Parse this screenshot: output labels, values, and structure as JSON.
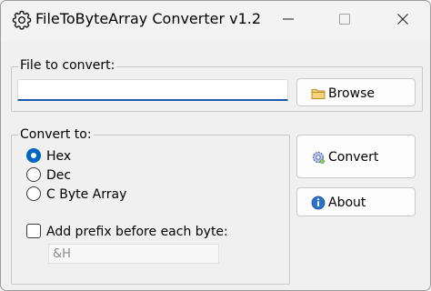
{
  "window": {
    "title": "FileToByteArray Converter v1.2",
    "app_icon": "gear-icon",
    "controls": [
      "minimize-icon",
      "maximize-icon",
      "close-icon"
    ]
  },
  "file_group": {
    "label": "File to convert:",
    "input_value": "",
    "browse_label": "Browse",
    "browse_icon": "folder-icon"
  },
  "convert_group": {
    "label": "Convert to:",
    "options": [
      {
        "label": "Hex",
        "checked": true
      },
      {
        "label": "Dec",
        "checked": false
      },
      {
        "label": "C Byte Array",
        "checked": false
      }
    ],
    "prefix_checkbox_label": "Add prefix before each byte:",
    "prefix_checked": false,
    "prefix_value": "&H"
  },
  "actions": {
    "convert_label": "Convert",
    "convert_icon": "gear-icon",
    "about_label": "About",
    "about_icon": "info-icon"
  },
  "colors": {
    "accent": "#0067c0",
    "window_bg": "#f0f0f0",
    "input_underline": "#1f5aa6"
  }
}
